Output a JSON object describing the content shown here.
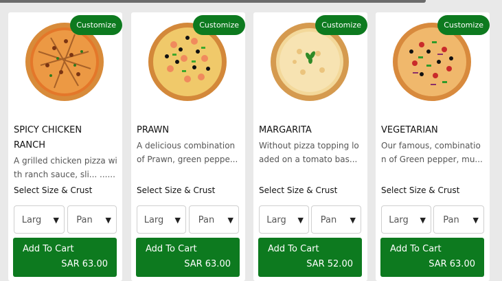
{
  "customize_label": "Customize",
  "select_label": "Select Size & Crust",
  "add_label": "Add To Cart",
  "size_value": "Larg",
  "crust_value": "Pan",
  "products": [
    {
      "name_line1": "SPICY CHICKEN",
      "name_line2": "RANCH",
      "desc_line1": "A grilled chicken pizza wi",
      "desc_line2": "th ranch sauce, sli... ......",
      "price": "SAR 63.00"
    },
    {
      "name_line1": "PRAWN",
      "name_line2": "",
      "desc_line1": "A delicious combination",
      "desc_line2": "of Prawn, green peppe...",
      "price": "SAR 63.00"
    },
    {
      "name_line1": "MARGARITA",
      "name_line2": "",
      "desc_line1": "Without pizza topping lo",
      "desc_line2": "aded on a tomato bas...",
      "price": "SAR 52.00"
    },
    {
      "name_line1": "VEGETARIAN",
      "name_line2": "",
      "desc_line1": "Our famous, combinatio",
      "desc_line2": "n of Green pepper, mu...",
      "price": "SAR 63.00"
    }
  ],
  "colors": {
    "accent_green": "#0d7a1f",
    "crust": "#d9943d",
    "sauce": "#e07a28",
    "cheese": "#f3d89a"
  }
}
